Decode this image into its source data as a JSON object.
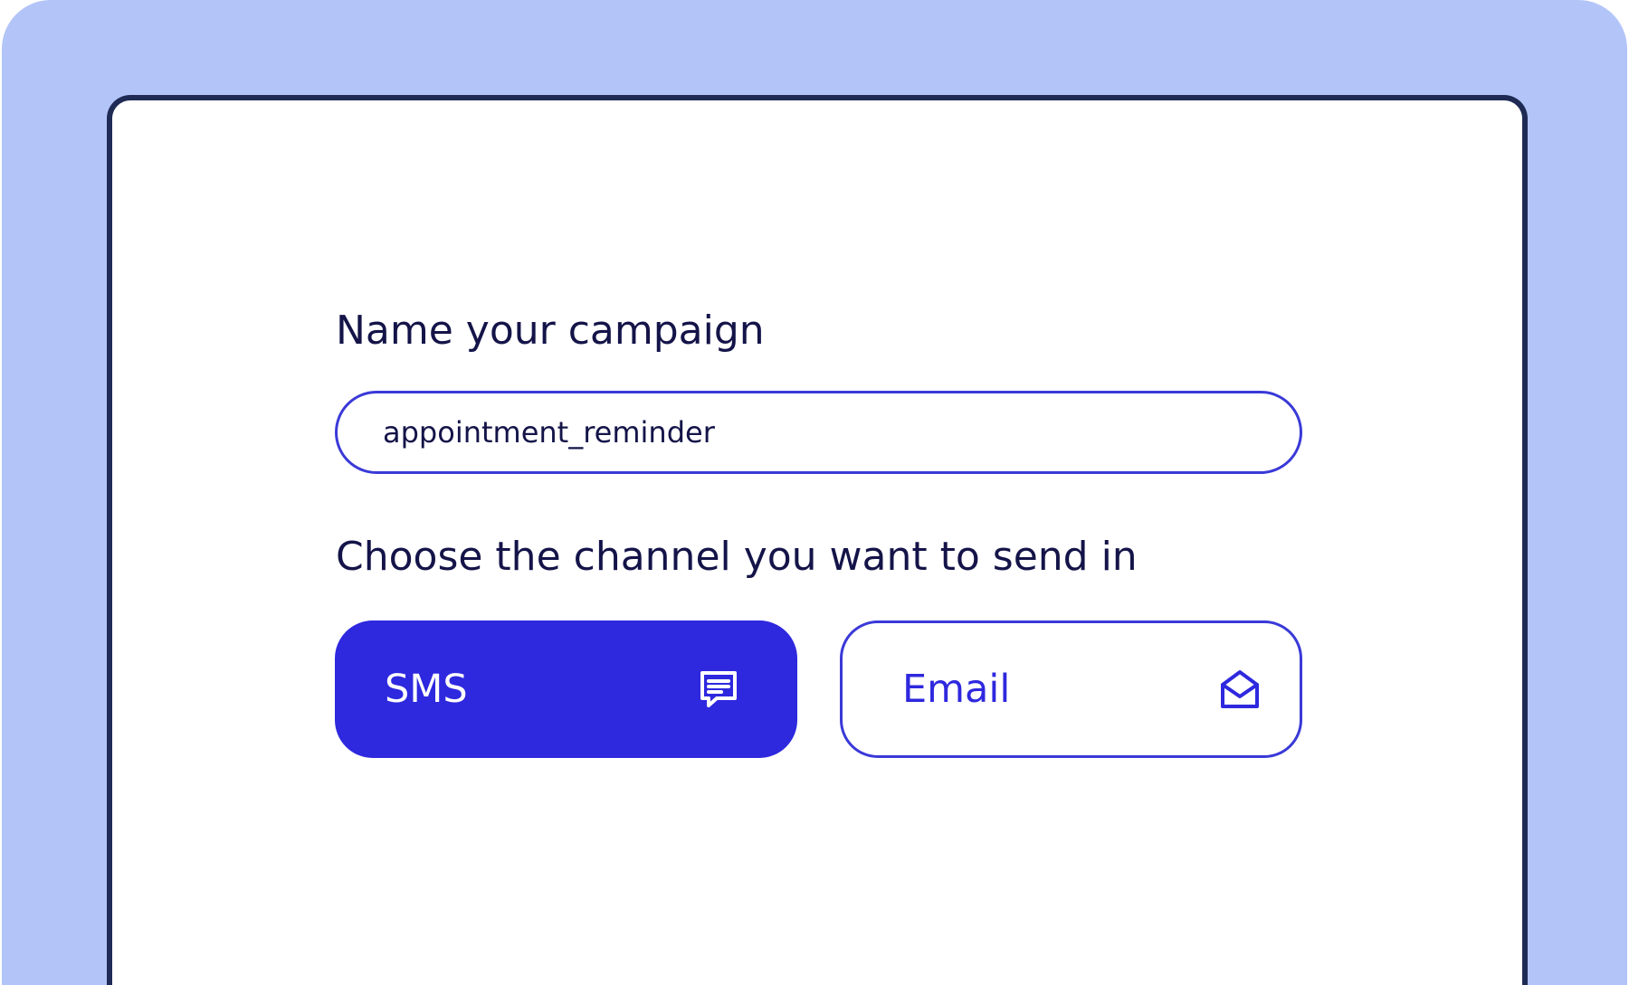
{
  "form": {
    "name_heading": "Name your campaign",
    "name_value": "appointment_reminder",
    "channel_heading": "Choose the channel you want to send in"
  },
  "channels": [
    {
      "label": "SMS",
      "icon": "chat-message-icon",
      "selected": true
    },
    {
      "label": "Email",
      "icon": "open-envelope-icon",
      "selected": false
    }
  ],
  "colors": {
    "background": "#b3c5f8",
    "accent": "#2e28de",
    "heading_text": "#141449",
    "panel_border": "#1f2a55"
  }
}
